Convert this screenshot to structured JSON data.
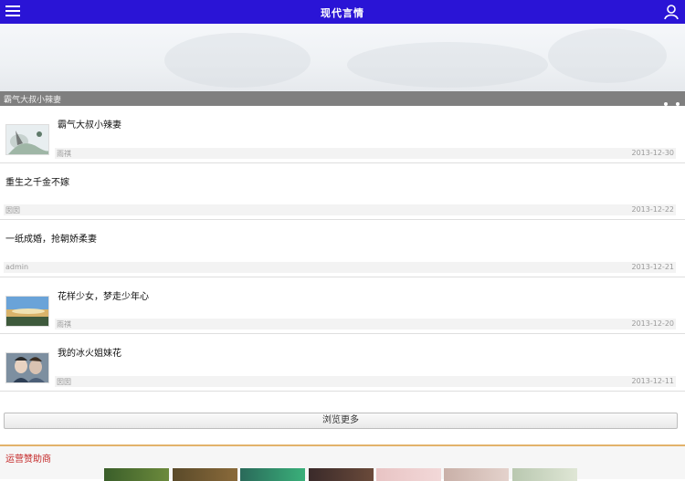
{
  "header": {
    "title": "现代言情",
    "menu_icon": "hamburger-menu-icon",
    "user_icon": "user-icon"
  },
  "banner": {
    "caption": "霸气大叔小辣妻"
  },
  "articles": [
    {
      "title": "霸气大叔小辣妻",
      "author": "雨祺",
      "date": "2013-12-30",
      "has_thumb": true
    },
    {
      "title": "重生之千金不嫁",
      "author": "囡囡",
      "date": "2013-12-22",
      "has_thumb": false
    },
    {
      "title": "一纸成婚，抢朝娇柔妻",
      "author": "admin",
      "date": "2013-12-21",
      "has_thumb": false
    },
    {
      "title": "花样少女，梦走少年心",
      "author": "雨祺",
      "date": "2013-12-20",
      "has_thumb": true
    },
    {
      "title": "我的冰火姐妹花",
      "author": "囡囡",
      "date": "2013-12-11",
      "has_thumb": true
    }
  ],
  "more_button": "浏览更多",
  "sponsors": {
    "label": "运营赞助商"
  },
  "colors": {
    "header_bg": "#2a14d6",
    "caption_bg": "#7f7f7f",
    "sponsor_label": "#c42828",
    "sponsor_border": "#e2b26a"
  }
}
